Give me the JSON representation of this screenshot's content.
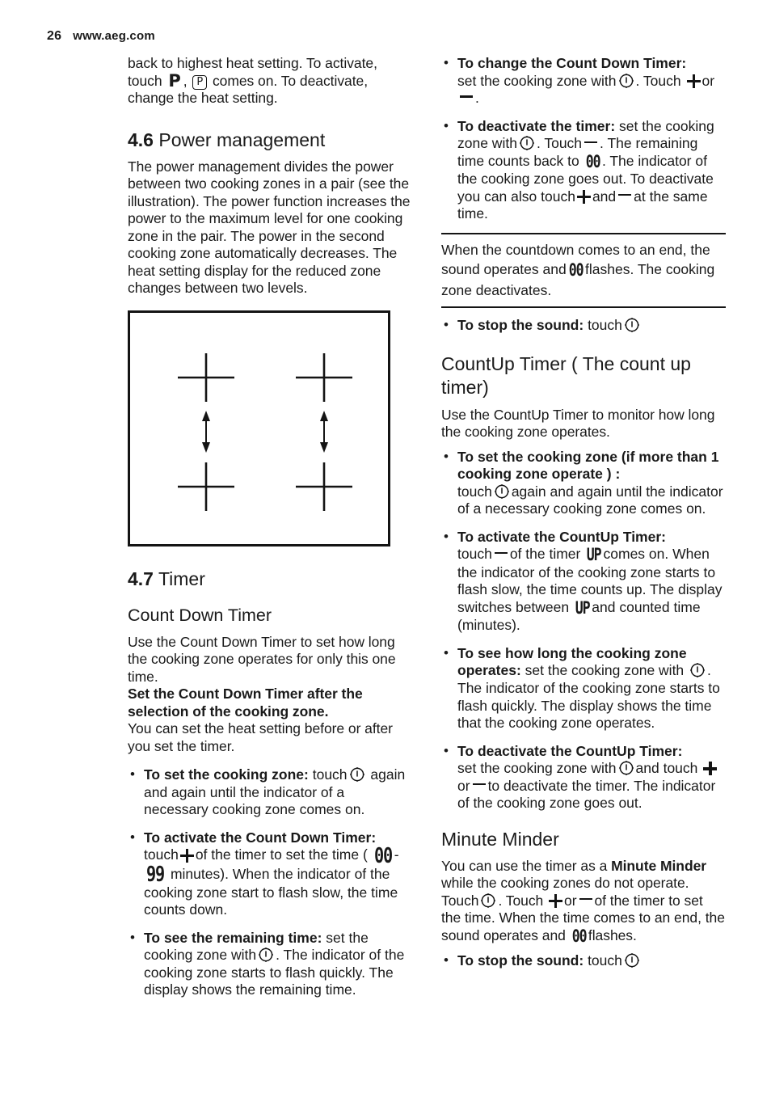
{
  "header": {
    "page_number": "26",
    "website": "www.aeg.com"
  },
  "left_column": {
    "continued_paragraph": {
      "part1": "back to highest heat setting. To activate, touch",
      "symbol_p": "P",
      "part2": ",",
      "symbol_p_boxed": "P",
      "part3": "comes on. To deactivate, change the heat setting."
    },
    "section_4_6": {
      "number": "4.6",
      "title": "Power management",
      "paragraph": "The power management divides the power between two cooking zones in a pair (see the illustration). The power function increases the power to the maximum level for one cooking zone in the pair. The power in the second cooking zone automatically decreases. The heat setting display for the reduced zone changes between two levels."
    },
    "illustration": {
      "name": "cooking-zone-pair-diagram",
      "zones": 4,
      "arrows": 2,
      "description": "Hob with four cooking zone crosses arranged in two pairs, each pair linked by a vertical double-headed arrow"
    },
    "section_4_7": {
      "number": "4.7",
      "title": "Timer"
    },
    "count_down_timer": {
      "heading": "Count Down Timer",
      "intro": "Use the Count Down Timer to set how long the cooking zone operates for only this one time.",
      "bold_note": "Set the Count Down Timer after the selection of the cooking zone.",
      "after_note": "You can set the heat setting before or after you set the timer.",
      "bullets": [
        {
          "label": "To set the cooking zone:",
          "text_before_icon": "touch",
          "icon": "timer-clock-icon",
          "text_after_icon": "again and again until the indicator of a necessary cooking zone comes on."
        },
        {
          "label": "To activate the Count Down Timer:",
          "text_1": "touch",
          "icon_plus": "plus-icon",
          "text_2": "of the timer to set the time (",
          "display_from": "00",
          "display_dash": "-",
          "display_to": "99",
          "text_3": "minutes). When the indicator of the cooking zone start to flash slow, the time counts down."
        },
        {
          "label": "To see the remaining time:",
          "text_1": "set the cooking zone with",
          "icon": "timer-clock-icon",
          "text_2": ". The indicator of the cooking zone starts to flash quickly. The display shows the remaining time."
        }
      ]
    }
  },
  "right_column": {
    "count_down_continued": [
      {
        "label": "To change the Count Down Timer:",
        "text_1": "set the cooking zone with",
        "icon": "timer-clock-icon",
        "text_2": ". Touch",
        "icon_plus": "plus-icon",
        "text_3": "or",
        "icon_minus": "minus-icon",
        "text_4": "."
      },
      {
        "label": "To deactivate the timer:",
        "text_1": "set the cooking zone with",
        "icon": "timer-clock-icon",
        "text_2": ". Touch",
        "icon_minus": "minus-icon",
        "text_3": ". The remaining time counts back to",
        "display_zero": "00",
        "text_4": ". The indicator of the cooking zone goes out. To deactivate you can also touch",
        "icon_plus": "plus-icon",
        "text_5": "and",
        "icon_minus_2": "minus-icon",
        "text_6": "at the same time."
      }
    ],
    "note_box": {
      "text_1": "When the countdown comes to an end, the sound operates and",
      "display_zero": "00",
      "text_2": "flashes. The cooking zone deactivates."
    },
    "stop_sound_bullet_1": {
      "label": "To stop the sound:",
      "text": "touch",
      "icon": "timer-clock-icon"
    },
    "count_up_timer": {
      "heading": "CountUp Timer ( The count up timer)",
      "intro": "Use the CountUp Timer to monitor how long the cooking zone operates.",
      "bullets": [
        {
          "label": "To set the cooking zone (if more than 1 cooking zone operate ) :",
          "text_1": "touch",
          "icon": "timer-clock-icon",
          "text_2": "again and again until the indicator of a necessary cooking zone comes on."
        },
        {
          "label": "To activate the CountUp Timer:",
          "text_1": "touch",
          "icon_minus": "minus-icon",
          "text_2": "of the timer",
          "display_up": "UP",
          "text_3": "comes on. When the indicator of the cooking zone starts to flash slow, the time counts up. The display switches between",
          "display_up_2": "UP",
          "text_4": "and counted time (minutes)."
        },
        {
          "label": "To see how long the cooking zone operates:",
          "text_1": "set the cooking zone with",
          "icon": "timer-clock-icon",
          "text_2": ". The indicator of the cooking zone starts to flash quickly. The display shows the time that the cooking zone operates."
        },
        {
          "label": "To deactivate the CountUp Timer:",
          "text_1": "set the cooking zone with",
          "icon": "timer-clock-icon",
          "text_2": "and touch",
          "icon_plus": "plus-icon",
          "text_3": "or",
          "icon_minus": "minus-icon",
          "text_4": "to deactivate the timer. The indicator of the cooking zone goes out."
        }
      ]
    },
    "minute_minder": {
      "heading": "Minute Minder",
      "text_1": "You can use the timer as a",
      "bold_term": "Minute Minder",
      "text_2": "while the cooking zones do not operate. Touch",
      "icon": "timer-clock-icon",
      "text_3": ". Touch",
      "icon_plus": "plus-icon",
      "text_4": "or",
      "icon_minus": "minus-icon",
      "text_5": "of the timer to set the time. When the time comes to an end, the sound operates and",
      "display_zero": "00",
      "text_6": "flashes.",
      "stop_sound": {
        "label": "To stop the sound:",
        "text": "touch",
        "icon": "timer-clock-icon"
      }
    }
  },
  "colors": {
    "text": "#1a1a1a",
    "rule": "#141414",
    "background": "#ffffff"
  }
}
